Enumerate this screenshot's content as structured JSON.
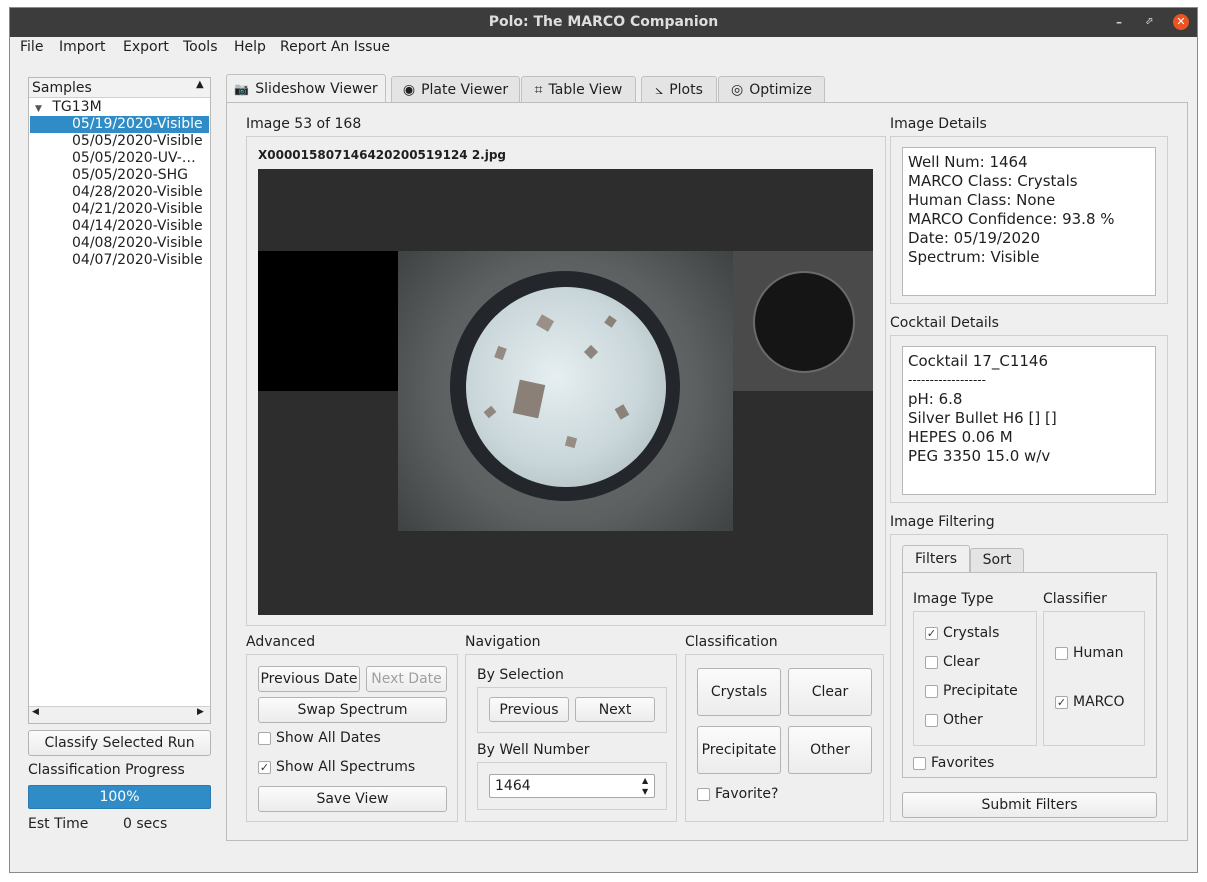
{
  "window": {
    "title": "Polo: The MARCO Companion",
    "minimize": "–",
    "maximize": "⬀",
    "close": "✕"
  },
  "menu": [
    "File",
    "Import",
    "Export",
    "Tools",
    "Help",
    "Report An Issue"
  ],
  "samples": {
    "header": "Samples",
    "root": "TG13M",
    "runs": [
      "05/19/2020-Visible",
      "05/05/2020-Visible",
      "05/05/2020-UV-…",
      "05/05/2020-SHG",
      "04/28/2020-Visible",
      "04/21/2020-Visible",
      "04/14/2020-Visible",
      "04/08/2020-Visible",
      "04/07/2020-Visible"
    ],
    "selected_index": 0,
    "classify_button": "Classify Selected Run",
    "progress_label": "Classification Progress",
    "progress_text": "100%",
    "progress_value": 1.0,
    "est_time_label": "Est Time",
    "est_time_value": "0 secs"
  },
  "tabs": [
    "Slideshow Viewer",
    "Plate Viewer",
    "Table View",
    "Plots",
    "Optimize"
  ],
  "viewer": {
    "image_counter": "Image 53 of 168",
    "filename": "X000015807146420200519124 2.jpg"
  },
  "image_details": {
    "title": "Image Details",
    "lines": [
      "Well Num: 1464",
      "MARCO Class: Crystals",
      "Human Class: None",
      "MARCO Confidence: 93.8 %",
      "Date: 05/19/2020",
      "Spectrum: Visible"
    ]
  },
  "cocktail_details": {
    "title": "Cocktail Details",
    "lines": [
      "Cocktail 17_C1146",
      "------------------",
      "pH: 6.8",
      "Silver Bullet H6 [] []",
      "HEPES 0.06 M",
      "PEG 3350 15.0 w/v"
    ]
  },
  "advanced": {
    "title": "Advanced",
    "previous_date": "Previous Date",
    "next_date": "Next Date",
    "swap_spectrum": "Swap Spectrum",
    "show_all_dates": "Show All Dates",
    "show_all_dates_checked": false,
    "show_all_spectrums": "Show All Spectrums",
    "show_all_spectrums_checked": true,
    "save_view": "Save View"
  },
  "navigation": {
    "title": "Navigation",
    "by_selection": "By Selection",
    "previous": "Previous",
    "next": "Next",
    "by_well_number": "By Well Number",
    "well_number": "1464"
  },
  "classification": {
    "title": "Classification",
    "crystals": "Crystals",
    "clear": "Clear",
    "precipitate": "Precipitate",
    "other": "Other",
    "favorite": "Favorite?",
    "favorite_checked": false
  },
  "filtering": {
    "title": "Image Filtering",
    "tab_filters": "Filters",
    "tab_sort": "Sort",
    "image_type_title": "Image Type",
    "classifier_title": "Classifier",
    "crystals": "Crystals",
    "crystals_checked": true,
    "clear": "Clear",
    "clear_checked": false,
    "precipitate": "Precipitate",
    "precipitate_checked": false,
    "other": "Other",
    "other_checked": false,
    "human": "Human",
    "human_checked": false,
    "marco": "MARCO",
    "marco_checked": true,
    "favorites": "Favorites",
    "favorites_checked": false,
    "submit": "Submit Filters"
  },
  "check_glyph": "✓"
}
